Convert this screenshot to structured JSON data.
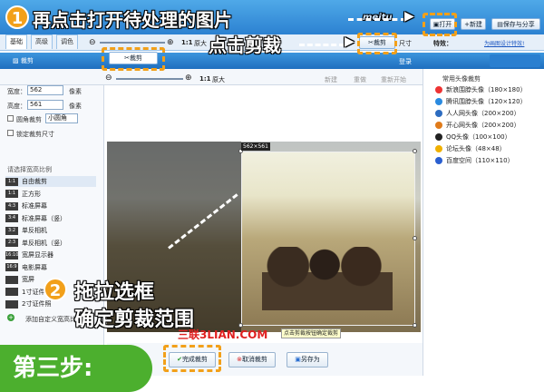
{
  "top": {
    "tabs": [
      "基础",
      "高级",
      "调色"
    ],
    "open_label": "打开",
    "new_label": "新建",
    "save_share_label": "保存与分享",
    "size_label": "尺寸",
    "effects_label": "特效：",
    "designer_link": "为画图设计特效!",
    "zoom_ratio": "1:1",
    "zoom_label": "原大",
    "crop_label": "裁剪",
    "crop_tool_label": "裁剪"
  },
  "dialog": {
    "title": "裁剪",
    "login": "登录",
    "zoom_ratio": "1:1",
    "zoom_label": "原大",
    "toolbar": {
      "new": "新建",
      "redo": "重做",
      "reset": "重新开始"
    }
  },
  "left": {
    "width_label": "宽度：",
    "width_value": "562",
    "height_label": "高度：",
    "height_value": "561",
    "unit": "像素",
    "round_crop": "圆角裁剪",
    "round_select": "小圆角",
    "lock_size": "锁定裁剪尺寸",
    "ratio_header": "请选择宽高比例",
    "ratios": [
      {
        "icon": "1:1",
        "label": "自由裁剪"
      },
      {
        "icon": "1:1",
        "label": "正方形"
      },
      {
        "icon": "4:3",
        "label": "标准屏幕"
      },
      {
        "icon": "3:4",
        "label": "标准屏幕（竖）"
      },
      {
        "icon": "3:2",
        "label": "单反相机"
      },
      {
        "icon": "2:3",
        "label": "单反相机（竖）"
      },
      {
        "icon": "16:10",
        "label": "宽屏显示器"
      },
      {
        "icon": "16:9",
        "label": "电影屏幕"
      },
      {
        "icon": "",
        "label": "宽屏"
      },
      {
        "icon": "",
        "label": "1寸证件"
      },
      {
        "icon": "",
        "label": "2寸证件照"
      }
    ],
    "add_custom": "添加自定义宽高比"
  },
  "right": {
    "header": "常用头像裁剪",
    "items": [
      {
        "label": "新浪围脖头像（180×180）",
        "color": "#e33"
      },
      {
        "label": "腾讯围脖头像（120×120）",
        "color": "#2a8ae0"
      },
      {
        "label": "人人网头像（200×200）",
        "color": "#2d6cc0"
      },
      {
        "label": "开心网头像（200×200）",
        "color": "#e07b1a"
      },
      {
        "label": "QQ头像（100×100）",
        "color": "#222"
      },
      {
        "label": "论坛头像（48×48）",
        "color": "#f0b000"
      },
      {
        "label": "百度空间（110×110）",
        "color": "#2a5fd0"
      }
    ]
  },
  "canvas": {
    "size_badge": "562×561",
    "hint": "点击剪裁按钮确定裁剪",
    "watermark": "三联3LIAN.COM",
    "logo": "meitu"
  },
  "bottom": {
    "confirm": "完成裁剪",
    "cancel": "取消裁剪",
    "save_as": "另存为"
  },
  "annotations": {
    "step1_num": "1",
    "step1_text": "再点击打开待处理的图片",
    "click_crop": "点击剪裁",
    "step2_num": "2",
    "step2_line1": "拖拉选框",
    "step2_line2": "确定剪裁范围",
    "step_title": "第三步:"
  },
  "colors": {
    "accent": "#f2a01a",
    "step_green": "#4caf2e",
    "header_blue": "#2a7fd0"
  }
}
